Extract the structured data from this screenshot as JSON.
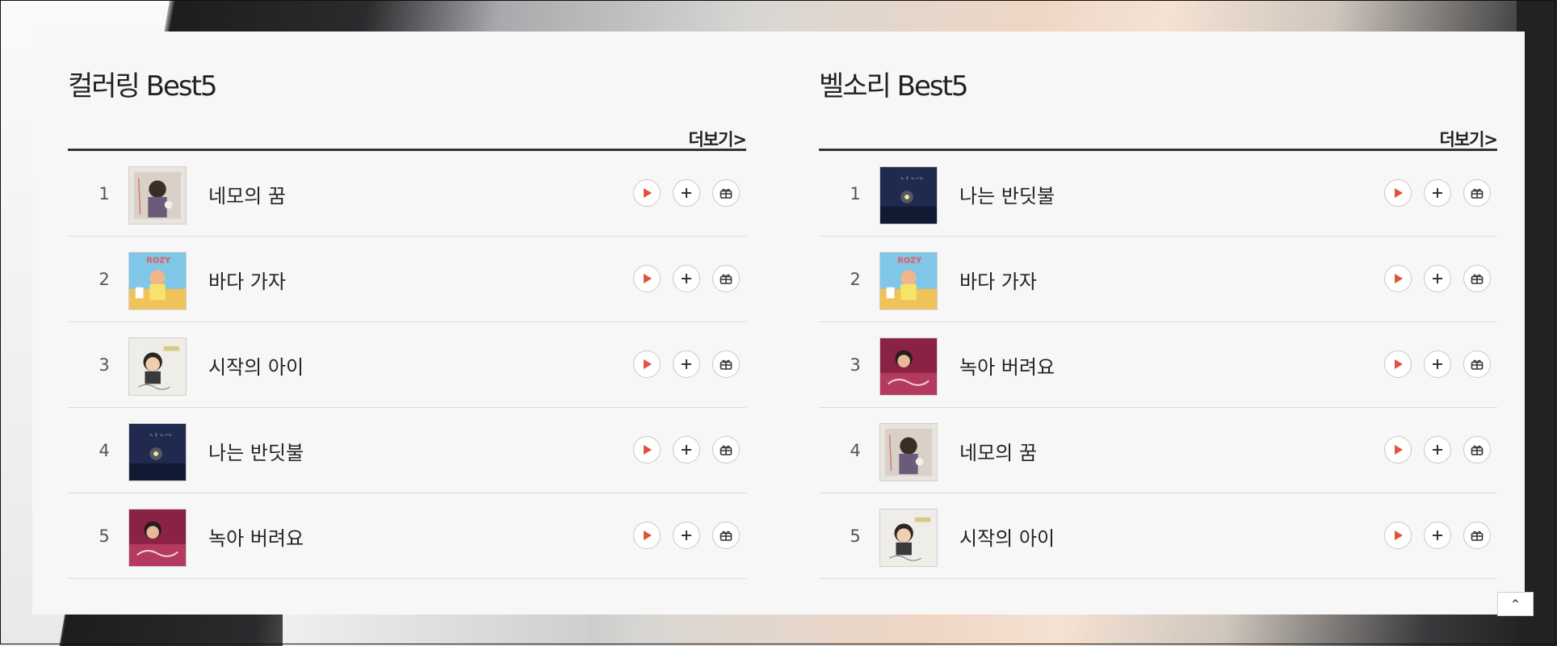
{
  "colors": {
    "panel_bg": "#f7f7f7",
    "play_accent": "#e2513c",
    "text": "#222222",
    "divider": "#dcdcdc"
  },
  "left": {
    "title": "컬러링 Best5",
    "more_label": "더보기>",
    "items": [
      {
        "rank": "1",
        "title": "네모의 꿈",
        "art": "nemo"
      },
      {
        "rank": "2",
        "title": "바다 가자",
        "art": "rozy"
      },
      {
        "rank": "3",
        "title": "시작의 아이",
        "art": "boy"
      },
      {
        "rank": "4",
        "title": "나는 반딧불",
        "art": "firefly"
      },
      {
        "rank": "5",
        "title": "녹아 버려요",
        "art": "melt"
      }
    ]
  },
  "right": {
    "title": "벨소리 Best5",
    "more_label": "더보기>",
    "items": [
      {
        "rank": "1",
        "title": "나는 반딧불",
        "art": "firefly"
      },
      {
        "rank": "2",
        "title": "바다 가자",
        "art": "rozy"
      },
      {
        "rank": "3",
        "title": "녹아 버려요",
        "art": "melt"
      },
      {
        "rank": "4",
        "title": "네모의 꿈",
        "art": "nemo"
      },
      {
        "rank": "5",
        "title": "시작의 아이",
        "art": "boy"
      }
    ]
  },
  "actions": {
    "play_icon": "play-icon",
    "add_icon": "plus-icon",
    "gift_icon": "gift-icon"
  },
  "scroll_top_label": "⌃"
}
